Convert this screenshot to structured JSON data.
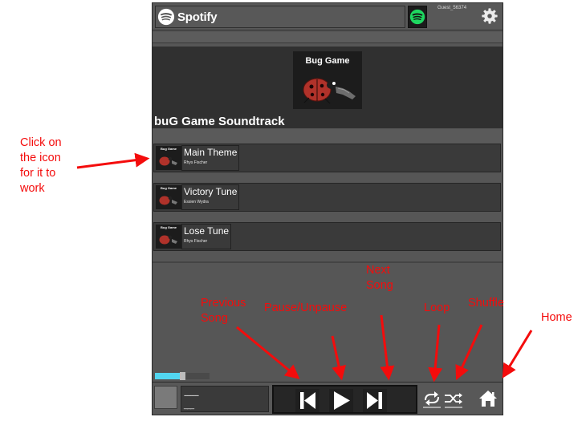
{
  "header": {
    "brand": "Spotify",
    "username": "Guest_56374"
  },
  "album": {
    "art_title": "Bug Game",
    "title": "buG Game Soundtrack"
  },
  "tracks": [
    {
      "name": "Main Theme",
      "artist": "Rhys Fischer",
      "thumb_title": "Bug Game"
    },
    {
      "name": "Victory Tune",
      "artist": "Essien Wydra",
      "thumb_title": "Bug Game"
    },
    {
      "name": "Lose Tune",
      "artist": "Rhys Fischer",
      "thumb_title": "Bug Game"
    }
  ],
  "now_playing": {
    "line1": "---------",
    "line2": "___",
    "progress": 0.5
  },
  "annotations": {
    "click_icon": [
      "Click on",
      "the icon",
      "for it to",
      "work"
    ],
    "previous": [
      "Previous",
      "Song"
    ],
    "pause": "Pause/Unpause",
    "next": [
      "Next",
      "Song"
    ],
    "loop": "Loop",
    "shuffle": "Shuffle",
    "home": "Home"
  },
  "colors": {
    "annotation": "#f40c0c",
    "progress": "#52d6f0",
    "spotify_green": "#1ed760"
  },
  "icons": [
    "spotify-logo-icon",
    "spotify-account-icon",
    "gear-icon",
    "previous-icon",
    "play-icon",
    "next-icon",
    "loop-icon",
    "shuffle-icon",
    "home-icon"
  ]
}
